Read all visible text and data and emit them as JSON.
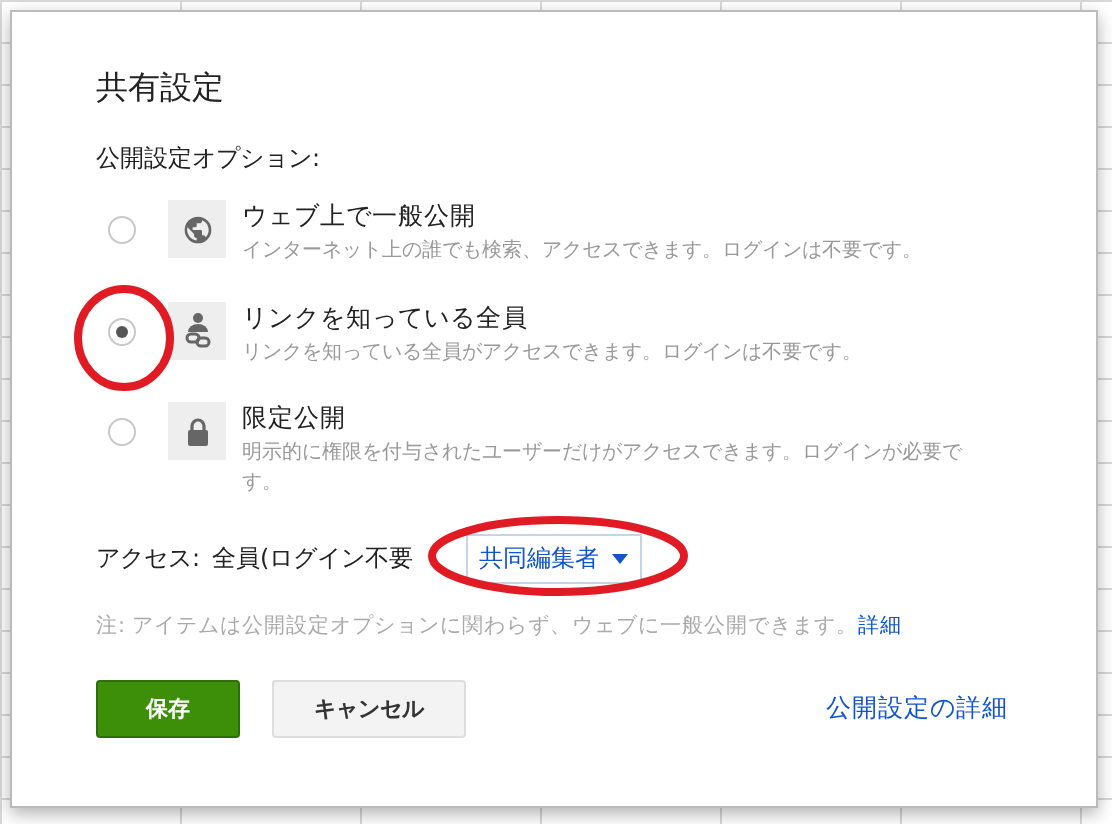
{
  "dialog": {
    "title": "共有設定",
    "options_label": "公開設定オプション:",
    "options": [
      {
        "kind": "globe",
        "title": "ウェブ上で一般公開",
        "description": "インターネット上の誰でも検索、アクセスできます。ログインは不要です。",
        "selected": false
      },
      {
        "kind": "link",
        "title": "リンクを知っている全員",
        "description": "リンクを知っている全員がアクセスできます。ログインは不要です。",
        "selected": true
      },
      {
        "kind": "lock",
        "title": "限定公開",
        "description": "明示的に権限を付与されたユーザーだけがアクセスできます。ログインが必要です。",
        "selected": false
      }
    ],
    "access": {
      "label": "アクセス:",
      "value": "全員(ログイン不要",
      "role": "共同編集者"
    },
    "note": "注: アイテムは公開設定オプションに関わらず、ウェブに一般公開できます。",
    "note_link": "詳細",
    "save": "保存",
    "cancel": "キャンセル",
    "details_link": "公開設定の詳細"
  }
}
